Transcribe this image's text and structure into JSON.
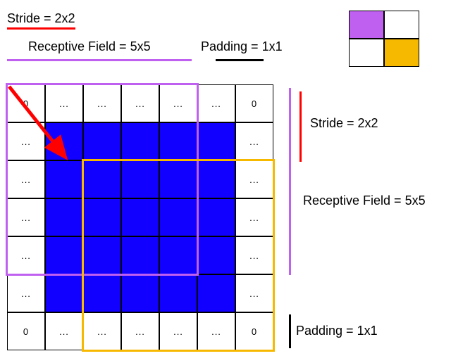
{
  "labels": {
    "stride_top": "Stride = 2x2",
    "rf_top": "Receptive Field = 5x5",
    "pad_top": "Padding = 1x1",
    "stride_side": "Stride = 2x2",
    "rf_side": "Receptive Field = 5x5",
    "pad_side": "Padding = 1x1"
  },
  "grid": {
    "size": 7,
    "corner_value": "0",
    "pad_value": "...",
    "inner_color": "#1100ff",
    "cells": [
      [
        "0",
        "...",
        "...",
        "...",
        "...",
        "...",
        "0"
      ],
      [
        "...",
        "B",
        "B",
        "B",
        "B",
        "B",
        "..."
      ],
      [
        "...",
        "B",
        "B",
        "B",
        "B",
        "B",
        "..."
      ],
      [
        "...",
        "B",
        "B",
        "B",
        "B",
        "B",
        "..."
      ],
      [
        "...",
        "B",
        "B",
        "B",
        "B",
        "B",
        "..."
      ],
      [
        "...",
        "B",
        "B",
        "B",
        "B",
        "B",
        "..."
      ],
      [
        "0",
        "...",
        "...",
        "...",
        "...",
        "...",
        "0"
      ]
    ]
  },
  "receptive_fields": {
    "purple": {
      "row": 0,
      "col": 0,
      "span": 5,
      "color": "#c060f0"
    },
    "orange": {
      "row": 2,
      "col": 2,
      "span": 5,
      "color": "#f7b900"
    }
  },
  "stride_arrow": {
    "from": [
      0,
      0
    ],
    "to": [
      2,
      2
    ],
    "color": "#ff0000"
  },
  "mini_legend": {
    "cells": [
      {
        "r": 0,
        "c": 0,
        "fill": "#c060f0"
      },
      {
        "r": 0,
        "c": 1,
        "fill": "#ffffff"
      },
      {
        "r": 1,
        "c": 0,
        "fill": "#ffffff"
      },
      {
        "r": 1,
        "c": 1,
        "fill": "#f7b900"
      }
    ]
  },
  "chart_data": {
    "type": "table",
    "description": "Illustration of a convolution: 7x7 padded input (5x5 interior in blue), 5x5 receptive field (purple then orange) moving with stride 2x2 (red arrow), producing a 2x2 output (top-right mini-grid, top-left purple, bottom-right orange).",
    "input_size": [
      5,
      5
    ],
    "padding": [
      1,
      1
    ],
    "padded_size": [
      7,
      7
    ],
    "kernel_size": [
      5,
      5
    ],
    "stride": [
      2,
      2
    ],
    "output_size": [
      2,
      2
    ],
    "output_cell_colors": [
      [
        "#c060f0",
        "#ffffff"
      ],
      [
        "#ffffff",
        "#f7b900"
      ]
    ]
  }
}
